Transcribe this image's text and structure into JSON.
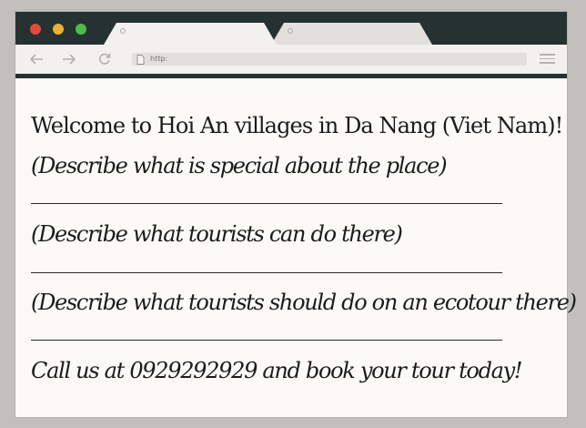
{
  "browser": {
    "address_placeholder": "http:",
    "colors": {
      "close": "#e14b3d",
      "minimize": "#e8b23a",
      "maximize": "#4fbb4b",
      "frame": "#263231",
      "active_tab": "#f2f1ef",
      "inactive_tab": "#e1e0dc"
    },
    "icons": [
      "back-arrow-icon",
      "forward-arrow-icon",
      "reload-icon",
      "page-icon",
      "hamburger-menu-icon"
    ]
  },
  "page": {
    "heading": "Welcome to Hoi An villages in Da Nang (Viet Nam)!",
    "prompt_special": "(Describe what is special about the place)",
    "prompt_activities": "(Describe what tourists can do there)",
    "prompt_ecotour": "(Describe what tourists should do on an ecotour there)",
    "call_to_action": "Call us at 0929292929 and book your tour today!"
  }
}
